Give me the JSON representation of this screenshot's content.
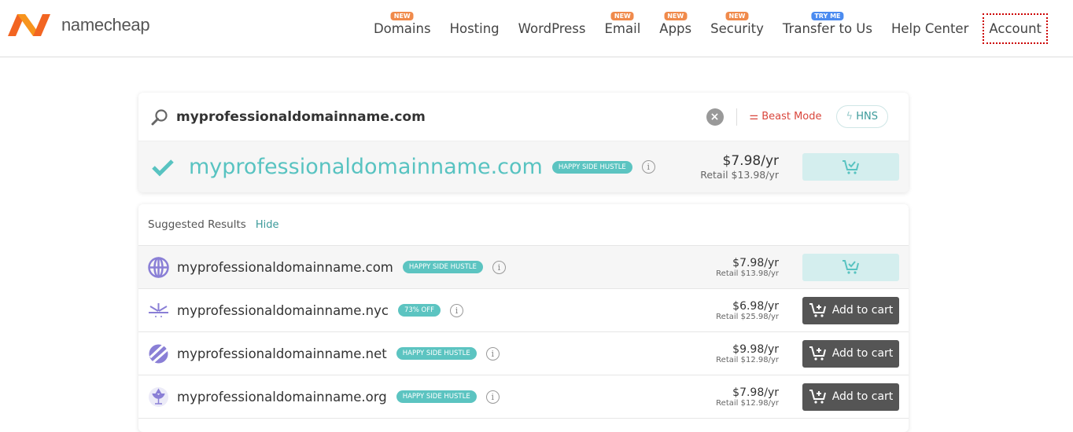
{
  "header": {
    "logo_text": "namecheap",
    "brand_color": "#f26522",
    "nav": [
      {
        "label": "Domains",
        "badge": "NEW"
      },
      {
        "label": "Hosting"
      },
      {
        "label": "WordPress"
      },
      {
        "label": "Email",
        "badge": "NEW"
      },
      {
        "label": "Apps",
        "badge": "NEW"
      },
      {
        "label": "Security",
        "badge": "NEW"
      },
      {
        "label": "Transfer to Us",
        "badge": "TRY ME"
      },
      {
        "label": "Help Center"
      },
      {
        "label": "Account"
      }
    ]
  },
  "search": {
    "value": "myprofessionaldomainname.com",
    "beast_mode": "Beast Mode",
    "hns": "HNS"
  },
  "main_result": {
    "domain": "myprofessionaldomainname.com",
    "tag": "HAPPY SIDE HUSTLE",
    "price": "$7.98/yr",
    "retail": "Retail $13.98/yr"
  },
  "suggested": {
    "title": "Suggested Results",
    "hide": "Hide",
    "rows": [
      {
        "domain": "myprofessionaldomainname.com",
        "tag": "HAPPY SIDE HUSTLE",
        "price": "$7.98/yr",
        "retail": "Retail $13.98/yr",
        "icon": "globe-icon",
        "in_cart": true
      },
      {
        "domain": "myprofessionaldomainname.nyc",
        "tag": "73% OFF",
        "price": "$6.98/yr",
        "retail": "Retail $25.98/yr",
        "icon": "nyc-icon",
        "button": "Add to cart"
      },
      {
        "domain": "myprofessionaldomainname.net",
        "tag": "HAPPY SIDE HUSTLE",
        "price": "$9.98/yr",
        "retail": "Retail $12.98/yr",
        "icon": "net-icon",
        "button": "Add to cart"
      },
      {
        "domain": "myprofessionaldomainname.org",
        "tag": "HAPPY SIDE HUSTLE",
        "price": "$7.98/yr",
        "retail": "Retail $12.98/yr",
        "icon": "org-icon",
        "button": "Add to cart"
      }
    ]
  }
}
